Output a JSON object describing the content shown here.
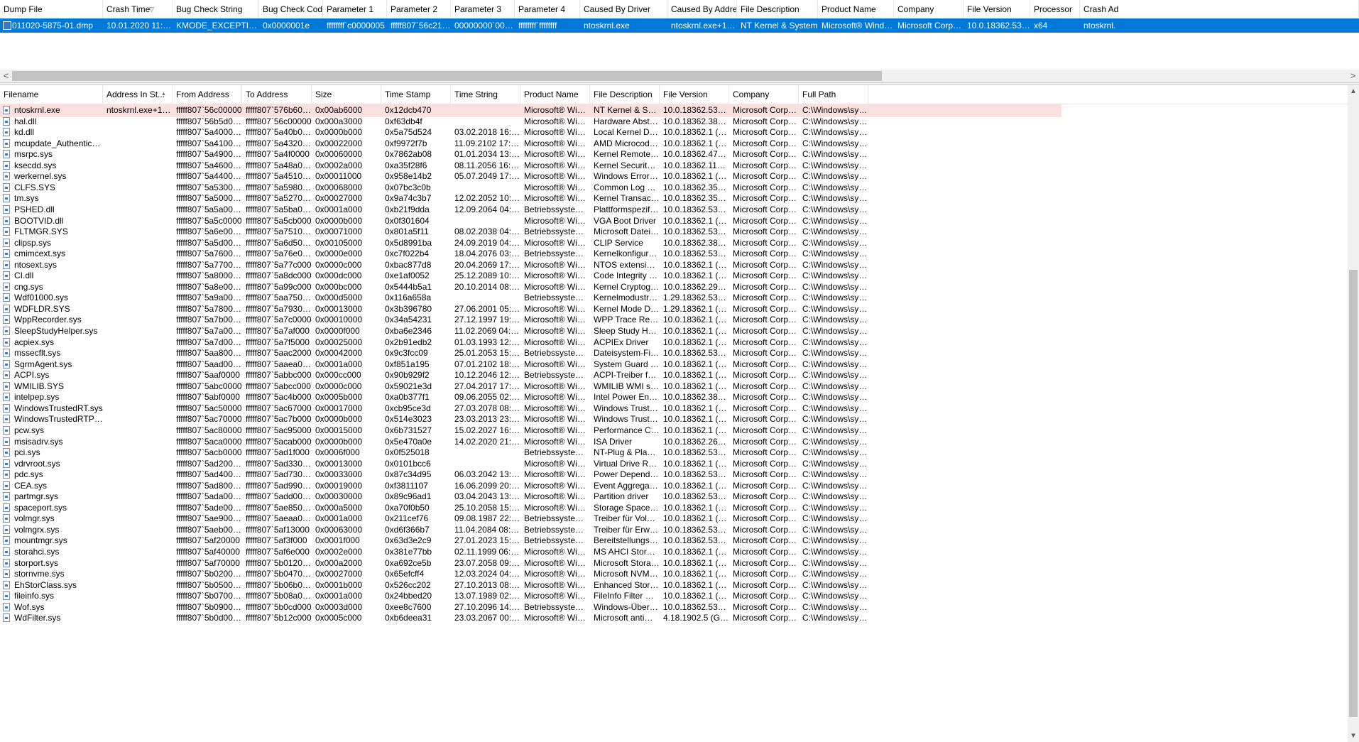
{
  "dump_list": {
    "columns": [
      "Dump File",
      "Crash Time",
      "Bug Check String",
      "Bug Check Code",
      "Parameter 1",
      "Parameter 2",
      "Parameter 3",
      "Parameter 4",
      "Caused By Driver",
      "Caused By Address",
      "File Description",
      "Product Name",
      "Company",
      "File Version",
      "Processor",
      "Crash Ad"
    ],
    "sort_indicator": "▽",
    "selected_row": [
      "011020-5875-01.dmp",
      "10.01.2020 11:40:20",
      "KMODE_EXCEPTION_N...",
      "0x0000001e",
      "ffffffff`c0000005",
      "fffff807`56c21e89",
      "00000000`000000...",
      "ffffffff`ffffffff",
      "ntoskrnl.exe",
      "ntoskrnl.exe+1c14e0",
      "NT Kernel & System",
      "Microsoft® Window...",
      "Microsoft Corpora...",
      "10.0.18362.535 (Wi...",
      "x64",
      "ntoskrnl."
    ]
  },
  "scrollbar": {
    "left_arrow": "<",
    "right_arrow": ">",
    "up_arrow": "▲",
    "down_arrow": "▼"
  },
  "driver_list": {
    "columns": [
      "Filename",
      "Address In St...",
      "From Address",
      "To Address",
      "Size",
      "Time Stamp",
      "Time String",
      "Product Name",
      "File Description",
      "File Version",
      "Company",
      "Full Path"
    ],
    "sort_indicator": "▲",
    "rows": [
      [
        "ntoskrnl.exe",
        "ntoskrnl.exe+1a1e72",
        "fffff807`56c00000",
        "fffff807`576b6000",
        "0x00ab6000",
        "0x12dcb470",
        "",
        "Microsoft® Wind...",
        "NT Kernel & System",
        "10.0.18362.535 (Wi...",
        "Microsoft Corpora...",
        "C:\\Windows\\syste..."
      ],
      [
        "hal.dll",
        "",
        "fffff807`56b5d000",
        "fffff807`56c00000",
        "0x000a3000",
        "0xf63db4f",
        "",
        "Microsoft® Wind...",
        "Hardware Abstract...",
        "10.0.18362.387 (Wi...",
        "Microsoft Corpora...",
        "C:\\Windows\\syste..."
      ],
      [
        "kd.dll",
        "",
        "fffff807`5a400000",
        "fffff807`5a40b000",
        "0x0000b000",
        "0x5a75d524",
        "03.02.2018 16:28:36",
        "Microsoft® Wind...",
        "Local Kernel Debu...",
        "10.0.18362.1 (WinB...",
        "Microsoft Corpora...",
        "C:\\Windows\\syste..."
      ],
      [
        "mcupdate_AuthenticAMD.dll",
        "",
        "fffff807`5a410000",
        "fffff807`5a432000",
        "0x00022000",
        "0xf9972f7b",
        "11.09.2102 17:21:15",
        "Microsoft® Wind...",
        "AMD Microcode U...",
        "10.0.18362.1 (WinB...",
        "Microsoft Corpora...",
        "C:\\Windows\\syste..."
      ],
      [
        "msrpc.sys",
        "",
        "fffff807`5a490000",
        "fffff807`5a4f0000",
        "0x00060000",
        "0x7862ab08",
        "01.01.2034 13:43:52",
        "Microsoft® Wind...",
        "Kernel Remote Pro...",
        "10.0.18362.476 (Wi...",
        "Microsoft Corpora...",
        "C:\\Windows\\syste..."
      ],
      [
        "ksecdd.sys",
        "",
        "fffff807`5a460000",
        "fffff807`5a48a000",
        "0x0002a000",
        "0xa35f28f6",
        "08.11.2056 16:23:34",
        "Microsoft® Wind...",
        "Kernel Security Su...",
        "10.0.18362.113 (Wi...",
        "Microsoft Corpora...",
        "C:\\Windows\\syste..."
      ],
      [
        "werkernel.sys",
        "",
        "fffff807`5a440000",
        "fffff807`5a451000",
        "0x00011000",
        "0x958e14b2",
        "05.07.2049 17:49:54",
        "Microsoft® Wind...",
        "Windows Error Re...",
        "10.0.18362.1 (WinB...",
        "Microsoft Corpora...",
        "C:\\Windows\\syste..."
      ],
      [
        "CLFS.SYS",
        "",
        "fffff807`5a530000",
        "fffff807`5a598000",
        "0x00068000",
        "0x07bc3c0b",
        "",
        "Microsoft® Wind...",
        "Common Log File ...",
        "10.0.18362.356 (Wi...",
        "Microsoft Corpora...",
        "C:\\Windows\\syste..."
      ],
      [
        "tm.sys",
        "",
        "fffff807`5a500000",
        "fffff807`5a527000",
        "0x00027000",
        "0x9a74c3b7",
        "12.02.2052 10:39:03",
        "Microsoft® Wind...",
        "Kernel Transaction ...",
        "10.0.18362.356 (Wi...",
        "Microsoft Corpora...",
        "C:\\Windows\\syste..."
      ],
      [
        "PSHED.dll",
        "",
        "fffff807`5a5a0000",
        "fffff807`5a5ba000",
        "0x0001a000",
        "0xb21f9dda",
        "12.09.2064 04:41:14",
        "Betriebssystem Mi...",
        "Plattformspezifisc...",
        "10.0.18362.530 (Wi...",
        "Microsoft Corpora...",
        "C:\\Windows\\syste..."
      ],
      [
        "BOOTVID.dll",
        "",
        "fffff807`5a5c0000",
        "fffff807`5a5cb000",
        "0x0000b000",
        "0x0f301604",
        "",
        "Microsoft® Wind...",
        "VGA Boot Driver",
        "10.0.18362.1 (WinB...",
        "Microsoft Corpora...",
        "C:\\Windows\\syste..."
      ],
      [
        "FLTMGR.SYS",
        "",
        "fffff807`5a6e0000",
        "fffff807`5a751000",
        "0x00071000",
        "0x801a5f11",
        "08.02.2038 04:18:41",
        "Betriebssystem Mi...",
        "Microsoft Dateisys...",
        "10.0.18362.530 (Wi...",
        "Microsoft Corpora...",
        "C:\\Windows\\syste..."
      ],
      [
        "clipsp.sys",
        "",
        "fffff807`5a5d0000",
        "fffff807`5a6d5000",
        "0x00105000",
        "0x5d8991ba",
        "24.09.2019 04:47:06",
        "Microsoft® Wind...",
        "CLIP Service",
        "10.0.18362.387 (Wi...",
        "Microsoft Corpora...",
        "C:\\Windows\\syste..."
      ],
      [
        "cmimcext.sys",
        "",
        "fffff807`5a760000",
        "fffff807`5a76e000",
        "0x0000e000",
        "0xc7f022b4",
        "18.04.2076 03:45:08",
        "Betriebssystem Mi...",
        "Kernelkonfiguratio...",
        "10.0.18362.530 (Wi...",
        "Microsoft Corpora...",
        "C:\\Windows\\syste..."
      ],
      [
        "ntosext.sys",
        "",
        "fffff807`5a770000",
        "fffff807`5a77c000",
        "0x0000c000",
        "0xbac877d8",
        "20.04.2069 17:14:16",
        "Microsoft® Wind...",
        "NTOS extension h...",
        "10.0.18362.1 (WinB...",
        "Microsoft Corpora...",
        "C:\\Windows\\syste..."
      ],
      [
        "CI.dll",
        "",
        "fffff807`5a800000",
        "fffff807`5a8dc000",
        "0x000dc000",
        "0xe1af0052",
        "25.12.2089 10:48:02",
        "Microsoft® Wind...",
        "Code Integrity Mo...",
        "10.0.18362.1 (WinB...",
        "Microsoft Corpora...",
        "C:\\Windows\\syste..."
      ],
      [
        "cng.sys",
        "",
        "fffff807`5a8e0000",
        "fffff807`5a99c000",
        "0x000bc000",
        "0x5444b5a1",
        "20.10.2014 08:11:29",
        "Microsoft® Wind...",
        "Kernel Cryptograp...",
        "10.0.18362.295 (Wi...",
        "Microsoft Corpora...",
        "C:\\Windows\\syste..."
      ],
      [
        "Wdf01000.sys",
        "",
        "fffff807`5a9a0000",
        "fffff807`5aa75000",
        "0x000d5000",
        "0x116a658a",
        "",
        "Betriebssystem Mi...",
        "Kernelmodustreib...",
        "1.29.18362.530 (Wi...",
        "Microsoft Corpora...",
        "C:\\Windows\\syste..."
      ],
      [
        "WDFLDR.SYS",
        "",
        "fffff807`5a780000",
        "fffff807`5a793000",
        "0x00013000",
        "0x3b396780",
        "27.06.2001 05:56:32",
        "Microsoft® Wind...",
        "Kernel Mode Drive...",
        "1.29.18362.1 (WinB...",
        "Microsoft Corpora...",
        "C:\\Windows\\syste..."
      ],
      [
        "WppRecorder.sys",
        "",
        "fffff807`5a7b0000",
        "fffff807`5a7c0000",
        "0x00010000",
        "0x34a54231",
        "27.12.1997 19:00:17",
        "Microsoft® Wind...",
        "WPP Trace Recorder",
        "10.0.18362.1 (WinB...",
        "Microsoft Corpora...",
        "C:\\Windows\\syste..."
      ],
      [
        "SleepStudyHelper.sys",
        "",
        "fffff807`5a7a0000",
        "fffff807`5a7af000",
        "0x0000f000",
        "0xba6e2346",
        "11.02.2069 04:49:26",
        "Microsoft® Wind...",
        "Sleep Study Helper",
        "10.0.18362.1 (WinB...",
        "Microsoft Corpora...",
        "C:\\Windows\\syste..."
      ],
      [
        "acpiex.sys",
        "",
        "fffff807`5a7d0000",
        "fffff807`5a7f5000",
        "0x00025000",
        "0x2b91edb2",
        "01.03.1993 12:04:18",
        "Microsoft® Wind...",
        "ACPIEx Driver",
        "10.0.18362.1 (WinB...",
        "Microsoft Corpora...",
        "C:\\Windows\\syste..."
      ],
      [
        "mssecflt.sys",
        "",
        "fffff807`5aa80000",
        "fffff807`5aac2000",
        "0x00042000",
        "0x9c3fcc09",
        "25.01.2053 15:04:57",
        "Betriebssystem Mi...",
        "Dateisystem-Filtert...",
        "10.0.18362.530 (Wi...",
        "Microsoft Corpora...",
        "C:\\Windows\\syste..."
      ],
      [
        "SgrmAgent.sys",
        "",
        "fffff807`5aad0000",
        "fffff807`5aaea000",
        "0x0001a000",
        "0xf851a195",
        "07.01.2102 18:49:09",
        "Microsoft® Wind...",
        "System Guard Run...",
        "10.0.18362.1 (WinB...",
        "Microsoft Corpora...",
        "C:\\Windows\\syste..."
      ],
      [
        "ACPI.sys",
        "",
        "fffff807`5aaf0000",
        "fffff807`5abbc000",
        "0x000cc000",
        "0x90b929f2",
        "10.12.2046 12:26:42",
        "Betriebssystem Mi...",
        "ACPI-Treiber für NT",
        "10.0.18362.1 (WinB...",
        "Microsoft Corpora...",
        "C:\\Windows\\syste..."
      ],
      [
        "WMILIB.SYS",
        "",
        "fffff807`5abc0000",
        "fffff807`5abcc000",
        "0x0000c000",
        "0x59021e3d",
        "27.04.2017 17:37:17",
        "Microsoft® Wind...",
        "WMILIB WMI supp...",
        "10.0.18362.1 (WinB...",
        "Microsoft Corpora...",
        "C:\\Windows\\syste..."
      ],
      [
        "intelpep.sys",
        "",
        "fffff807`5abf0000",
        "fffff807`5ac4b000",
        "0x0005b000",
        "0xa0b377f1",
        "09.06.2055 02:10:09",
        "Microsoft® Wind...",
        "Intel Power Engine...",
        "10.0.18362.387 (Wi...",
        "Microsoft Corpora...",
        "C:\\Windows\\syste..."
      ],
      [
        "WindowsTrustedRT.sys",
        "",
        "fffff807`5ac50000",
        "fffff807`5ac67000",
        "0x00017000",
        "0xcb95ce3d",
        "27.03.2078 08:41:49",
        "Microsoft® Wind...",
        "Windows Trusted ...",
        "10.0.18362.1 (WinB...",
        "Microsoft Corpora...",
        "C:\\Windows\\syste..."
      ],
      [
        "WindowsTrustedRTProxy.sys",
        "",
        "fffff807`5ac70000",
        "fffff807`5ac7b000",
        "0x0000b000",
        "0x514e3023",
        "23.03.2013 23:43:47",
        "Microsoft® Wind...",
        "Windows Trusted ...",
        "10.0.18362.1 (WinB...",
        "Microsoft Corpora...",
        "C:\\Windows\\syste..."
      ],
      [
        "pcw.sys",
        "",
        "fffff807`5ac80000",
        "fffff807`5ac95000",
        "0x00015000",
        "0x6b731527",
        "15.02.2027 16:09:27",
        "Microsoft® Wind...",
        "Performance Cou...",
        "10.0.18362.1 (WinB...",
        "Microsoft Corpora...",
        "C:\\Windows\\syste..."
      ],
      [
        "msisadrv.sys",
        "",
        "fffff807`5aca0000",
        "fffff807`5acab000",
        "0x0000b000",
        "0x5e470a0e",
        "14.02.2020 21:58:54",
        "Microsoft® Wind...",
        "ISA Driver",
        "10.0.18362.267 (Wi...",
        "Microsoft Corpora...",
        "C:\\Windows\\syste..."
      ],
      [
        "pci.sys",
        "",
        "fffff807`5acb0000",
        "fffff807`5ad1f000",
        "0x0006f000",
        "0x0f525018",
        "",
        "Betriebssystem Mi...",
        "NT-Plug & Play P...",
        "10.0.18362.530 (Wi...",
        "Microsoft Corpora...",
        "C:\\Windows\\syste..."
      ],
      [
        "vdrvroot.sys",
        "",
        "fffff807`5ad20000",
        "fffff807`5ad33000",
        "0x00013000",
        "0x0101bcc6",
        "",
        "Microsoft® Wind...",
        "Virtual Drive Root ...",
        "10.0.18362.1 (WinB...",
        "Microsoft Corpora...",
        "C:\\Windows\\syste..."
      ],
      [
        "pdc.sys",
        "",
        "fffff807`5ad40000",
        "fffff807`5ad73000",
        "0x00033000",
        "0x87c34d95",
        "06.03.2042 13:59:01",
        "Microsoft® Wind...",
        "Power Dependenc...",
        "10.0.18362.530 (Wi...",
        "Microsoft Corpora...",
        "C:\\Windows\\syste..."
      ],
      [
        "CEA.sys",
        "",
        "fffff807`5ad80000",
        "fffff807`5ad99000",
        "0x00019000",
        "0xf3811107",
        "16.06.2099 20:39:51",
        "Microsoft® Wind...",
        "Event Aggregation...",
        "10.0.18362.1 (WinB...",
        "Microsoft Corpora...",
        "C:\\Windows\\syste..."
      ],
      [
        "partmgr.sys",
        "",
        "fffff807`5ada0000",
        "fffff807`5add0000",
        "0x00030000",
        "0x89c96ad1",
        "03.04.2043 13:57:53",
        "Microsoft® Wind...",
        "Partition driver",
        "10.0.18362.530 (Wi...",
        "Microsoft Corpora...",
        "C:\\Windows\\syste..."
      ],
      [
        "spaceport.sys",
        "",
        "fffff807`5ade0000",
        "fffff807`5ae85000",
        "0x000a5000",
        "0xa70f0b50",
        "25.10.2058 15:16:48",
        "Microsoft® Wind...",
        "Storage Spaces Dri...",
        "10.0.18362.1 (WinB...",
        "Microsoft Corpora...",
        "C:\\Windows\\syste..."
      ],
      [
        "volmgr.sys",
        "",
        "fffff807`5ae90000",
        "fffff807`5aeaa000",
        "0x0001a000",
        "0x211cef76",
        "09.08.1987 22:53:58",
        "Betriebssystem Mi...",
        "Treiber für Volume...",
        "10.0.18362.1 (WinB...",
        "Microsoft Corpora...",
        "C:\\Windows\\syste..."
      ],
      [
        "volmgrx.sys",
        "",
        "fffff807`5aeb0000",
        "fffff807`5af13000",
        "0x00063000",
        "0xd6f366b7",
        "11.04.2084 08:16:07",
        "Betriebssystem Mi...",
        "Treiber für Erweiter...",
        "10.0.18362.530 (Wi...",
        "Microsoft Corpora...",
        "C:\\Windows\\syste..."
      ],
      [
        "mountmgr.sys",
        "",
        "fffff807`5af20000",
        "fffff807`5af3f000",
        "0x0001f000",
        "0x63d3e2c9",
        "27.01.2023 15:42:17",
        "Betriebssystem Mi...",
        "Bereitstellungspun...",
        "10.0.18362.530 (Wi...",
        "Microsoft Corpora...",
        "C:\\Windows\\syste..."
      ],
      [
        "storahci.sys",
        "",
        "fffff807`5af40000",
        "fffff807`5af6e000",
        "0x0002e000",
        "0x381e77bb",
        "02.11.1999 06:33:47",
        "Microsoft® Wind...",
        "MS AHCI Storport ...",
        "10.0.18362.1 (WinB...",
        "Microsoft Corpora...",
        "C:\\Windows\\syste..."
      ],
      [
        "storport.sys",
        "",
        "fffff807`5af70000",
        "fffff807`5b012000",
        "0x000a2000",
        "0xa692ce5b",
        "23.07.2058 09:35:39",
        "Microsoft® Wind...",
        "Microsoft Storage ...",
        "10.0.18362.1 (WinB...",
        "Microsoft Corpora...",
        "C:\\Windows\\syste..."
      ],
      [
        "stornvme.sys",
        "",
        "fffff807`5b020000",
        "fffff807`5b047000",
        "0x00027000",
        "0x65efcff4",
        "12.03.2024 04:45:56",
        "Microsoft® Wind...",
        "Microsoft NVM Ex...",
        "10.0.18362.1 (WinB...",
        "Microsoft Corpora...",
        "C:\\Windows\\syste..."
      ],
      [
        "EhStorClass.sys",
        "",
        "fffff807`5b050000",
        "fffff807`5b06b000",
        "0x0001b000",
        "0x526cc202",
        "27.10.2013 08:34:26",
        "Microsoft® Wind...",
        "Enhanced Storage ...",
        "10.0.18362.1 (WinB...",
        "Microsoft Corpora...",
        "C:\\Windows\\syste..."
      ],
      [
        "fileinfo.sys",
        "",
        "fffff807`5b070000",
        "fffff807`5b08a000",
        "0x0001a000",
        "0x24bbed20",
        "13.07.1989 02:15:12",
        "Microsoft® Wind...",
        "FileInfo Filter Driver",
        "10.0.18362.1 (WinB...",
        "Microsoft Corpora...",
        "C:\\Windows\\syste..."
      ],
      [
        "Wof.sys",
        "",
        "fffff807`5b090000",
        "fffff807`5b0cd000",
        "0x0003d000",
        "0xee8c7600",
        "27.10.2096 14:24:16",
        "Betriebssystem Mi...",
        "Windows-Überlap...",
        "10.0.18362.530 (Wi...",
        "Microsoft Corpora...",
        "C:\\Windows\\syste..."
      ],
      [
        "WdFilter.sys",
        "",
        "fffff807`5b0d0000",
        "fffff807`5b12c000",
        "0x0005c000",
        "0xb6deea31",
        "23.03.2067 00:30:57",
        "Microsoft® Wind...",
        "Microsoft antimal...",
        "4.18.1902.5 (GitEnli...",
        "Microsoft Corpora...",
        "C:\\Windows\\syste..."
      ]
    ]
  }
}
